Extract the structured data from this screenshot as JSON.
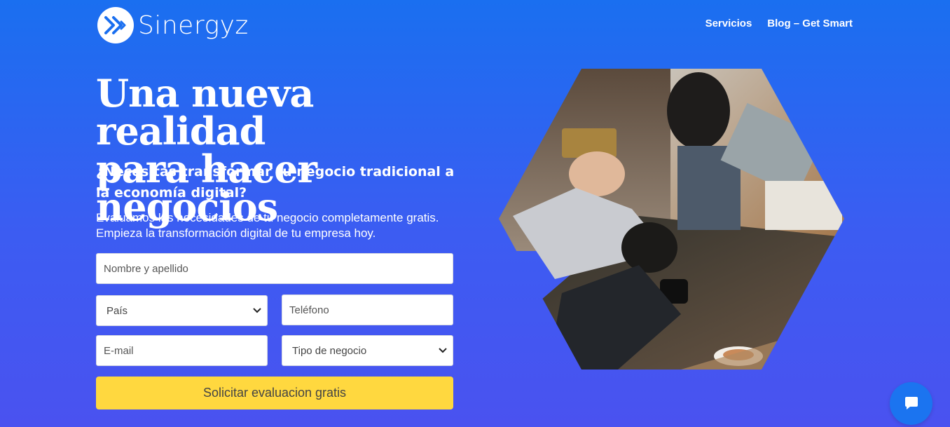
{
  "brand": {
    "name": "Sinergyz",
    "icon": "double-chevron-right-icon"
  },
  "nav": {
    "items": [
      "Servicios",
      "Blog – Get Smart"
    ]
  },
  "hero": {
    "headline_line1": "Una nueva realidad",
    "headline_line2": "para hacer negocios",
    "subheadline": "¿Necesitas transformar tu negocio tradicional a la economía digital?",
    "description": "Evaluamos las necesidades de tu negocio completamente gratis. Empieza la transformación digital de tu empresa hoy.",
    "image_description": "hexagon-photo-collage"
  },
  "form": {
    "name_placeholder": "Nombre y apellido",
    "country_selected": "País",
    "phone_placeholder": "Teléfono",
    "email_placeholder": "E-mail",
    "business_type_selected": "Tipo de negocio",
    "submit_label": "Solicitar evaluacion gratis"
  },
  "colors": {
    "background_top": "#1a6ff0",
    "background_bottom": "#4a52f0",
    "button": "#ffd83f",
    "chat_button": "#1b74f0"
  },
  "chat": {
    "icon": "chat-bubble-icon"
  }
}
